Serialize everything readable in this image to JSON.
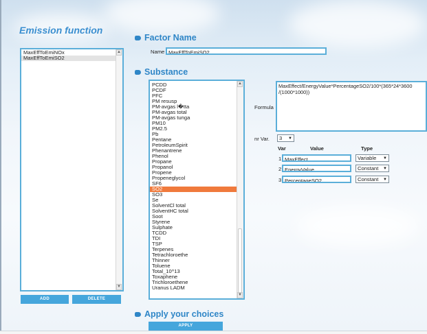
{
  "app": {
    "title": "Emission function"
  },
  "functions_list": {
    "items": [
      "MaxEffToEmiNOx",
      "MaxEffToEmiSO2"
    ],
    "selected": 1
  },
  "actions": {
    "add_label": "ADD",
    "delete_label": "DELETE"
  },
  "factor_name": {
    "heading": "Factor Name",
    "name_label": "Name",
    "name_value": "MaxEffToEmiSO2"
  },
  "substance": {
    "heading": "Substance",
    "items": [
      "PCDD",
      "PCDF",
      "PFC",
      "PM resusp",
      "PM-avgas l�tta",
      "PM-avgas total",
      "PM-avgas tunga",
      "PM10",
      "PM2.5",
      "Pb",
      "Pentane",
      "PetroleumSpirit",
      "Phenantrene",
      "Phenol",
      "Propane",
      "Propanol",
      "Propene",
      "Propeneglycol",
      "SF6",
      "SO2",
      "SO3",
      "Se",
      "SolventCl total",
      "SolventHC total",
      "Soot",
      "Styrene",
      "Sulphate",
      "TCDD",
      "TDI",
      "TSP",
      "Terpenes",
      "Tetrachloroethe",
      "Thinner",
      "Toluene",
      "Total_10^13",
      "Toxaphene",
      "Trichloroethene",
      "Uranus LADM"
    ],
    "selected": 19
  },
  "formula": {
    "label": "Formula",
    "value": "MaxEffect/EnergyValue*PercentageSO2/100*(365*24*3600 /(1000*1000))"
  },
  "nr_var": {
    "label": "nr Var.",
    "value": "3"
  },
  "var_table": {
    "headers": {
      "var": "Var",
      "value": "Value",
      "type": "Type"
    },
    "rows": [
      {
        "index": "1",
        "value": "MaxEffect",
        "type": "Variable"
      },
      {
        "index": "2",
        "value": "EnergyValue",
        "type": "Constant"
      },
      {
        "index": "3",
        "value": "PercentageSO2",
        "type": "Constant"
      }
    ]
  },
  "apply": {
    "heading": "Apply your choices",
    "button_label": "APPLY"
  },
  "colors": {
    "accent": "#2f86c7",
    "border": "#5aaed9",
    "selection": "#f07a3c",
    "button": "#45a6dc"
  }
}
